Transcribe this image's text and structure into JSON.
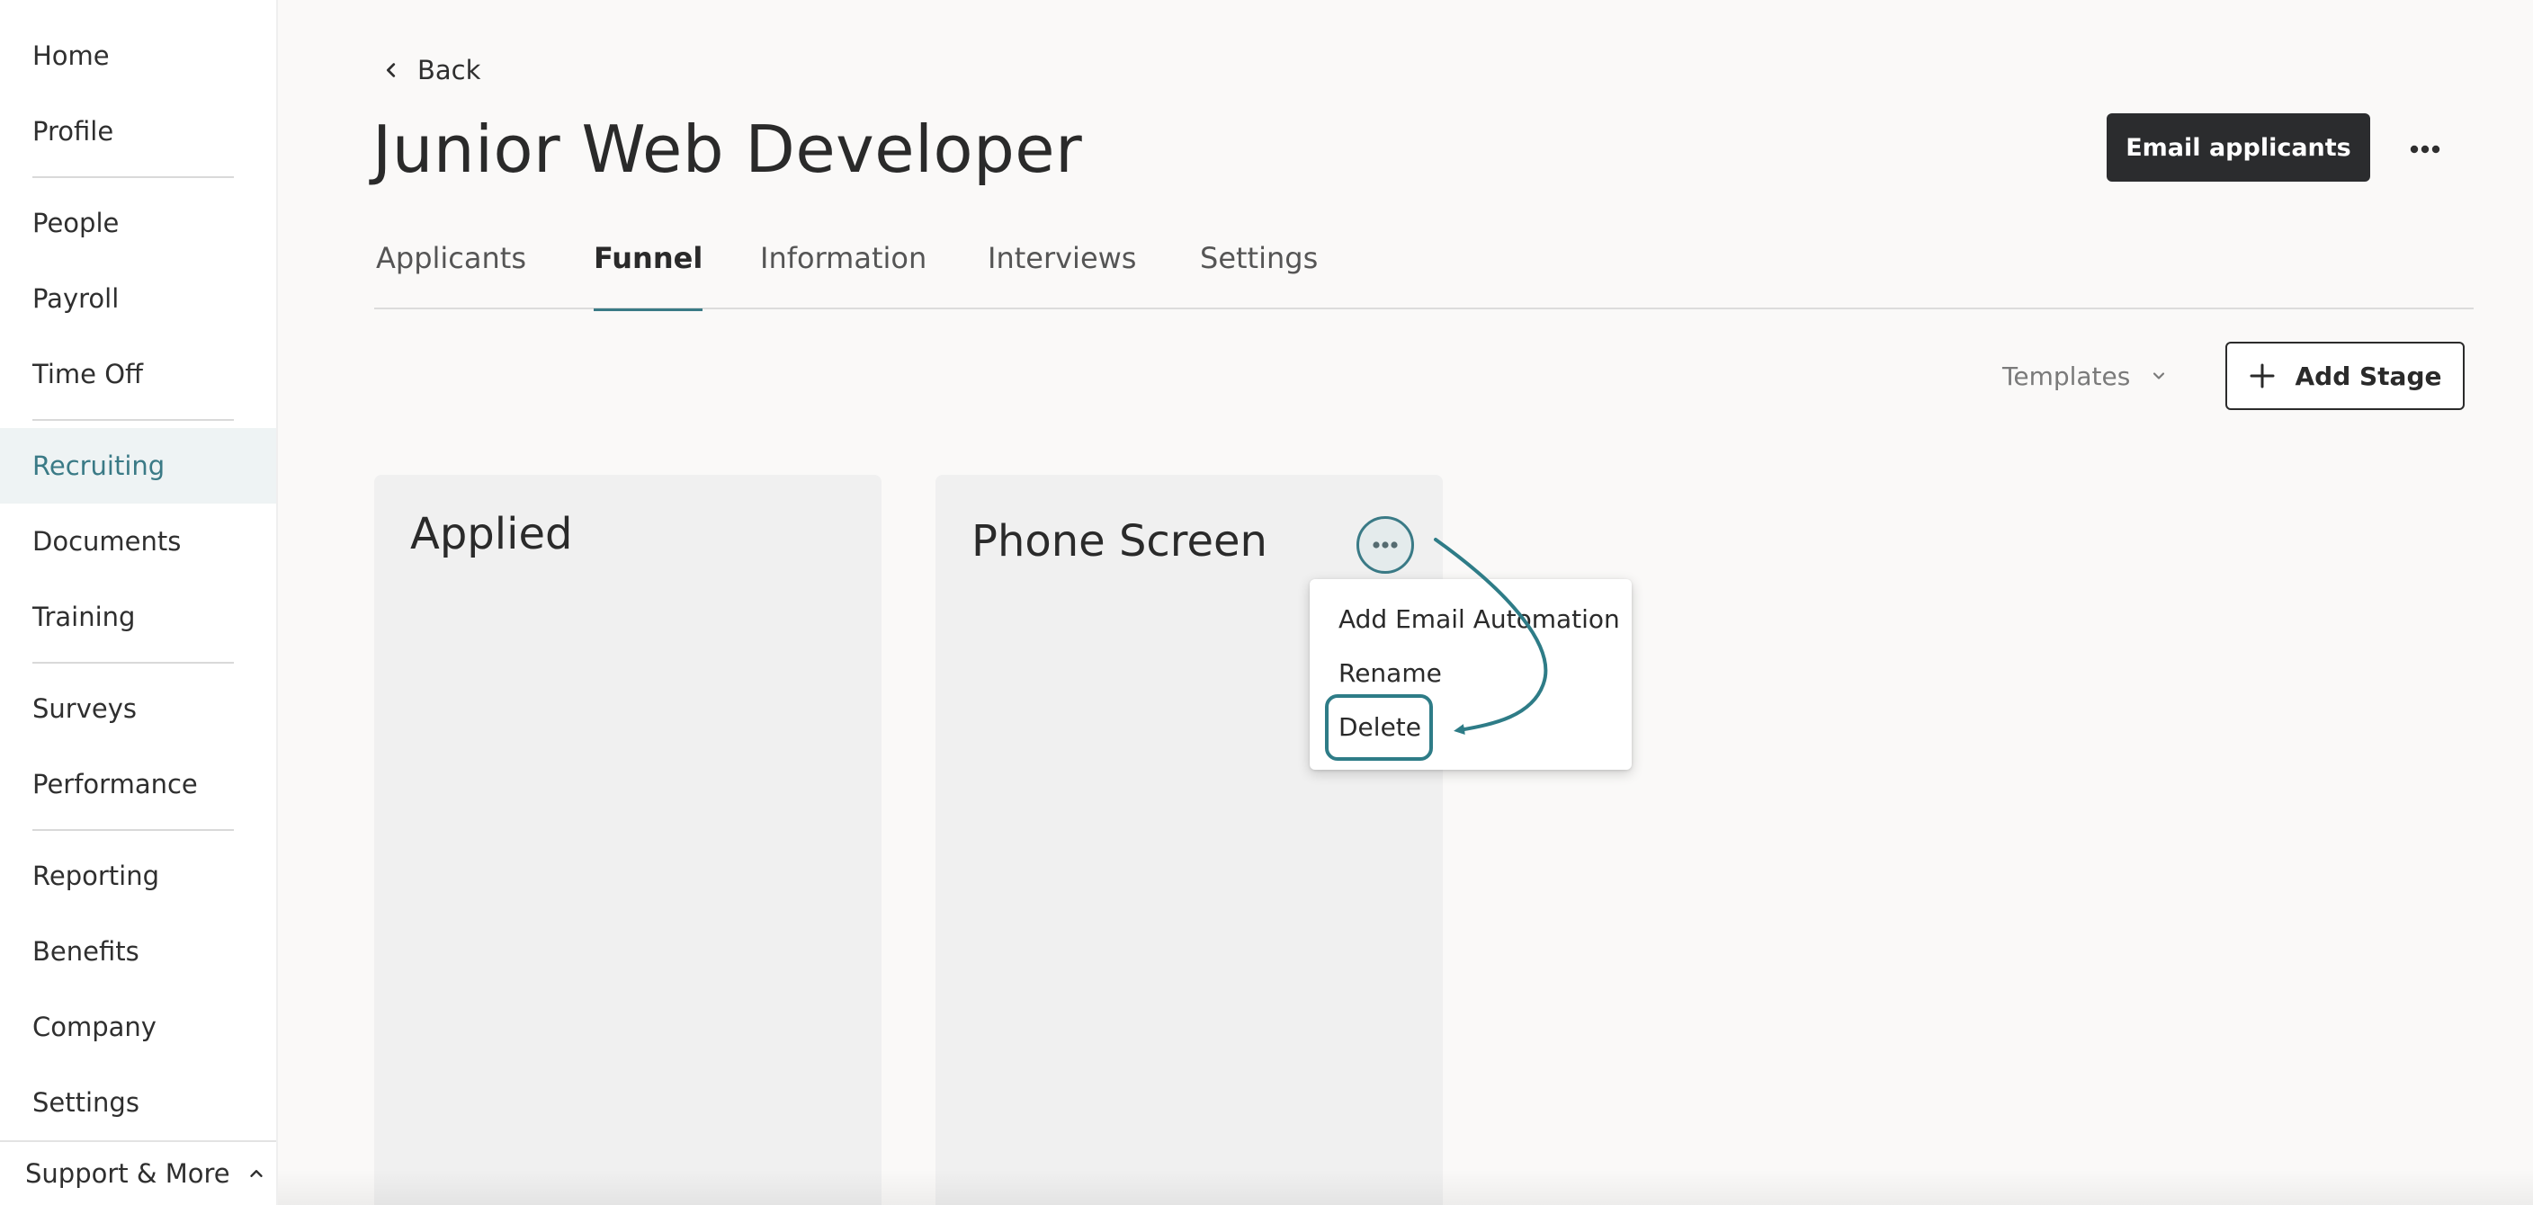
{
  "sidebar": {
    "items": [
      {
        "label": "Home"
      },
      {
        "label": "Profile"
      },
      {
        "label": "People"
      },
      {
        "label": "Payroll"
      },
      {
        "label": "Time Off"
      },
      {
        "label": "Recruiting",
        "active": true
      },
      {
        "label": "Documents"
      },
      {
        "label": "Training"
      },
      {
        "label": "Surveys"
      },
      {
        "label": "Performance"
      },
      {
        "label": "Reporting"
      },
      {
        "label": "Benefits"
      },
      {
        "label": "Company"
      },
      {
        "label": "Settings"
      }
    ],
    "support_label": "Support & More"
  },
  "header": {
    "back_label": "Back",
    "title": "Junior Web Developer",
    "email_button": "Email applicants"
  },
  "tabs": [
    {
      "label": "Applicants"
    },
    {
      "label": "Funnel",
      "active": true
    },
    {
      "label": "Information"
    },
    {
      "label": "Interviews"
    },
    {
      "label": "Settings"
    }
  ],
  "toolbar": {
    "templates_label": "Templates",
    "add_stage_label": "Add Stage"
  },
  "stages": [
    {
      "title": "Applied"
    },
    {
      "title": "Phone Screen"
    }
  ],
  "stage_menu": {
    "items": [
      {
        "label": "Add Email Automation"
      },
      {
        "label": "Rename"
      },
      {
        "label": "Delete",
        "highlighted": true
      }
    ]
  },
  "colors": {
    "accent": "#3a7a86",
    "highlight": "#2e7c87",
    "primary_button": "#2b2c2e"
  },
  "icons": {
    "back": "chevron-left-icon",
    "more": "more-horizontal-icon",
    "templates": "chevron-down-icon",
    "add": "plus-icon",
    "support": "chevron-up-icon"
  }
}
